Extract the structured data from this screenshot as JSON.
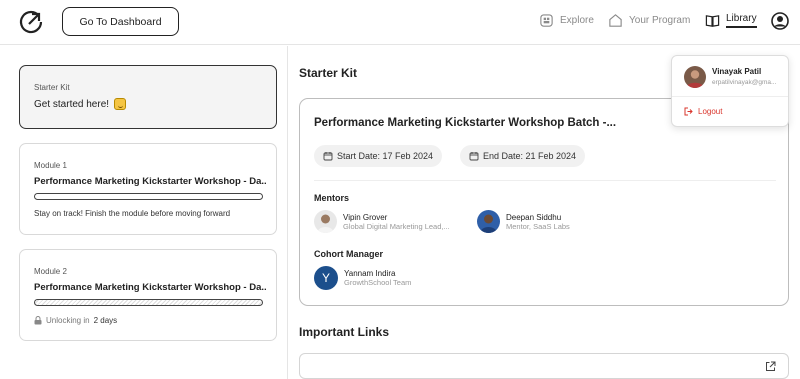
{
  "header": {
    "dashboard_button": "Go To Dashboard",
    "nav": [
      {
        "label": "Explore",
        "icon": "explore-icon"
      },
      {
        "label": "Your Program",
        "icon": "home-icon"
      },
      {
        "label": "Library",
        "icon": "book-icon",
        "active": true
      }
    ],
    "user_icon": "user-circle-icon"
  },
  "sidebar": {
    "starter_card": {
      "label": "Starter Kit",
      "title": "Get started here!",
      "icon": "smile-emoji-icon"
    },
    "modules": [
      {
        "label": "Module 1",
        "title": "Performance Marketing Kickstarter Workshop - Da...",
        "progress": 0,
        "note": "Stay on track! Finish the module before moving forward"
      },
      {
        "label": "Module 2",
        "title": "Performance Marketing Kickstarter Workshop - Da...",
        "progress": 0,
        "lock_prefix": "Unlocking in",
        "lock_value": "2 days"
      }
    ]
  },
  "main": {
    "title": "Starter Kit",
    "batch": {
      "title": "Performance Marketing Kickstarter Workshop Batch -...",
      "start_date": "Start Date: 17 Feb 2024",
      "end_date": "End Date: 21 Feb 2024",
      "mentors_label": "Mentors",
      "mentors": [
        {
          "name": "Vipin Grover",
          "role": "Global Digital Marketing Lead,..."
        },
        {
          "name": "Deepan Siddhu",
          "role": "Mentor, SaaS Labs"
        }
      ],
      "cohort_label": "Cohort Manager",
      "cohort_manager": {
        "initial": "Y",
        "name": "Yannam Indira",
        "role": "GrowthSchool Team"
      }
    },
    "links_title": "Important Links"
  },
  "dropdown": {
    "name": "Vinayak Patil",
    "email": "erpatilvinayak@gma...",
    "logout": "Logout"
  },
  "colors": {
    "accent_dark": "#222222",
    "logout_red": "#d9342b",
    "cohort_avatar": "#1c4f8c"
  }
}
